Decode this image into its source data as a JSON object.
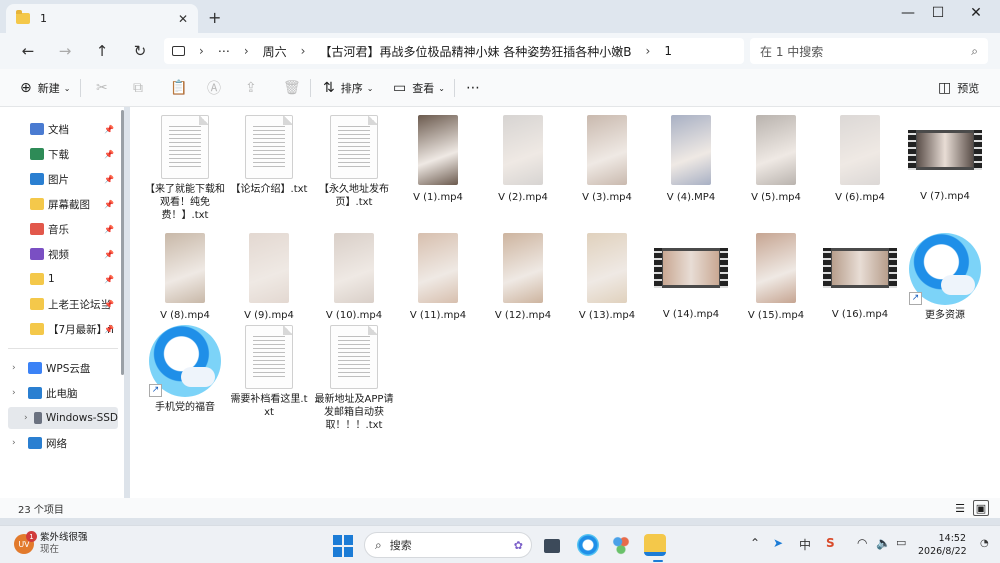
{
  "tab": {
    "title": "1",
    "close": "✕",
    "new": "+"
  },
  "window_controls": {
    "minimize": "—",
    "maximize": "☐",
    "close": "✕"
  },
  "nav": {
    "back": "←",
    "forward": "→",
    "up": "↑",
    "refresh": "↻"
  },
  "address": {
    "more": "⋯",
    "crumbs": [
      "周六",
      "【古河君】再战多位极品精神小妹 各种姿势狂插各种小嫩B",
      "1"
    ],
    "sep": "›"
  },
  "search": {
    "placeholder": "在 1 中搜索",
    "icon": "search-icon"
  },
  "commands": {
    "new": "新建",
    "sort": "排序",
    "view": "查看",
    "more": "⋯",
    "preview": "预览"
  },
  "sidebar": {
    "items": [
      {
        "label": "文档",
        "icon": "document-icon",
        "pinned": true
      },
      {
        "label": "下载",
        "icon": "download-icon",
        "pinned": true
      },
      {
        "label": "图片",
        "icon": "pictures-icon",
        "pinned": true
      },
      {
        "label": "屏幕截图",
        "icon": "folder-icon",
        "pinned": true
      },
      {
        "label": "音乐",
        "icon": "music-icon",
        "pinned": true
      },
      {
        "label": "视频",
        "icon": "video-icon",
        "pinned": true
      },
      {
        "label": "1",
        "icon": "folder-icon",
        "pinned": true
      },
      {
        "label": "上老王论坛当",
        "icon": "folder-icon",
        "pinned": true
      },
      {
        "label": "【7月最新】ñ",
        "icon": "folder-icon",
        "pinned": true
      }
    ],
    "tree": [
      {
        "label": "WPS云盘",
        "icon": "cloud-icon"
      },
      {
        "label": "此电脑",
        "icon": "computer-icon"
      },
      {
        "label": "Windows-SSD",
        "icon": "drive-icon"
      },
      {
        "label": "网络",
        "icon": "network-icon"
      }
    ],
    "pin": "📌"
  },
  "files": [
    {
      "name": "【来了就能下载和观看！纯免费！】.txt",
      "kind": "txt"
    },
    {
      "name": "【论坛介绍】.txt",
      "kind": "txt"
    },
    {
      "name": "【永久地址发布页】.txt",
      "kind": "txt"
    },
    {
      "name": "V (1).mp4",
      "kind": "video",
      "color": "#6b5a4e"
    },
    {
      "name": "V (2).mp4",
      "kind": "video",
      "color": "#d7d4d2"
    },
    {
      "name": "V (3).mp4",
      "kind": "video",
      "color": "#c9b9ae"
    },
    {
      "name": "V (4).MP4",
      "kind": "video",
      "color": "#a8b0c4"
    },
    {
      "name": "V (5).mp4",
      "kind": "video",
      "color": "#b9b3ae"
    },
    {
      "name": "V (6).mp4",
      "kind": "video",
      "color": "#dcd8d6"
    },
    {
      "name": "V (7).mp4",
      "kind": "film",
      "color": "#5b4f4a"
    },
    {
      "name": "V (8).mp4",
      "kind": "video",
      "color": "#c8b8a8"
    },
    {
      "name": "V (9).mp4",
      "kind": "video",
      "color": "#e3d8d1"
    },
    {
      "name": "V (10).mp4",
      "kind": "video",
      "color": "#d9cfc8"
    },
    {
      "name": "V (11).mp4",
      "kind": "video",
      "color": "#d7bfae"
    },
    {
      "name": "V (12).mp4",
      "kind": "video",
      "color": "#cdb49f"
    },
    {
      "name": "V (13).mp4",
      "kind": "video",
      "color": "#e0d1bd"
    },
    {
      "name": "V (14).mp4",
      "kind": "film",
      "color": "#c9a893"
    },
    {
      "name": "V (15).mp4",
      "kind": "video",
      "color": "#c6a592"
    },
    {
      "name": "V (16).mp4",
      "kind": "film",
      "color": "#b79e8c"
    },
    {
      "name": "更多资源",
      "kind": "edge"
    },
    {
      "name": "手机党的福音",
      "kind": "edge"
    },
    {
      "name": "需要补档看这里.txt",
      "kind": "txt"
    },
    {
      "name": "最新地址及APP请发邮箱自动获取！！！.txt",
      "kind": "txt"
    }
  ],
  "status": {
    "count": "23 个项目"
  },
  "taskbar": {
    "weather_temp": "UV",
    "weather_title": "紫外线很强",
    "weather_sub": "现在",
    "weather_badge": "1",
    "search_label": "搜索",
    "time": "14:52",
    "date": "2026/8/22",
    "ime": "中"
  }
}
